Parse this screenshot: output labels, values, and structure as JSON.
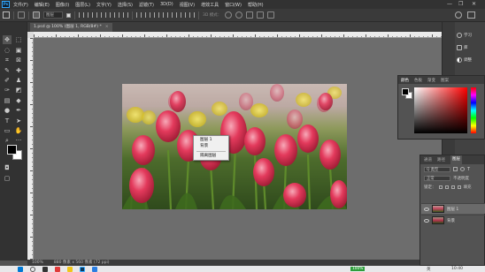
{
  "menubar": {
    "logo": "Ps",
    "items": [
      "文件(F)",
      "编辑(E)",
      "图像(I)",
      "图层(L)",
      "文字(Y)",
      "选择(S)",
      "滤镜(T)",
      "3D(D)",
      "视图(V)",
      "增效工具",
      "窗口(W)",
      "帮助(H)"
    ],
    "window_controls": [
      "—",
      "❐",
      "✕"
    ]
  },
  "options": {
    "auto_select_label": "自动选择：",
    "auto_select_value": "图层",
    "show_transform_label": "显示变换控件",
    "mode_3d_label": "3D 模式：",
    "more_label": "···"
  },
  "document": {
    "tab_title": "1.psd @ 100% (图层 1, RGB/8#) *",
    "close": "×"
  },
  "context_menu": {
    "items": [
      "图层 1",
      "背景",
      "隔离图层"
    ]
  },
  "status": {
    "zoom": "100%",
    "size": "880 像素 x 560 像素 (72 ppi)"
  },
  "right_column": {
    "items": [
      {
        "icon": "lightbulb-icon",
        "label": "学习"
      },
      {
        "icon": "library-icon",
        "label": "库"
      },
      {
        "icon": "adjust-icon",
        "label": "调整"
      }
    ]
  },
  "color_panel": {
    "tabs": [
      "颜色",
      "色板",
      "渐变",
      "图案"
    ],
    "active_tab": "颜色",
    "foreground": "#000000",
    "background": "#ffffff"
  },
  "layers_panel": {
    "tabs": [
      "通道",
      "路径",
      "图层"
    ],
    "active_tab": "图层",
    "filter_label": "Q 类型",
    "blend_mode": "正常",
    "opacity_label": "不透明度",
    "lock_label": "锁定：",
    "fill_label": "填充",
    "layers": [
      {
        "name": "图层 1",
        "selected": true
      },
      {
        "name": "背景",
        "selected": false
      }
    ]
  },
  "taskbar": {
    "input_method": "英",
    "zoom_badge": "100%",
    "time": "10:40"
  }
}
